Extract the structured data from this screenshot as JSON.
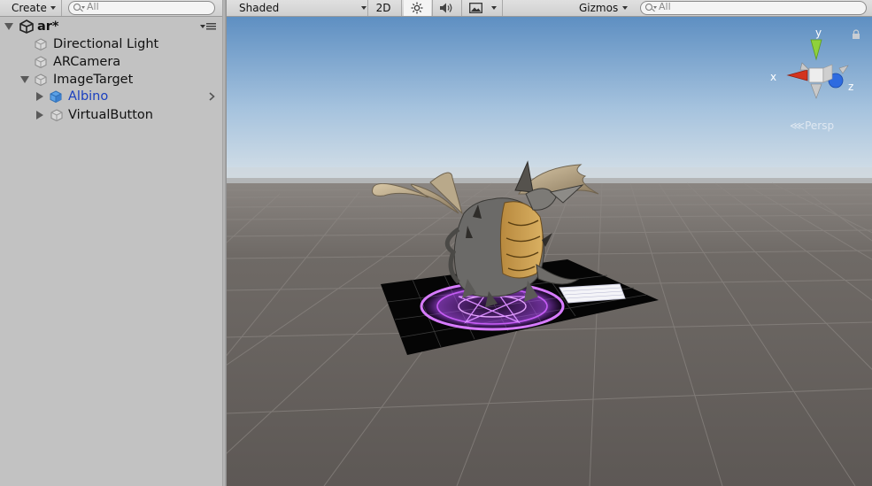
{
  "hierarchy": {
    "create_label": "Create",
    "search_placeholder": "All",
    "scene_name": "ar*",
    "items": [
      {
        "label": "Directional Light"
      },
      {
        "label": "ARCamera"
      },
      {
        "label": "ImageTarget"
      },
      {
        "label": "Albino"
      },
      {
        "label": "VirtualButton"
      }
    ]
  },
  "scene_view": {
    "shading_mode": "Shaded",
    "mode_2d_label": "2D",
    "gizmos_label": "Gizmos",
    "search_placeholder": "All",
    "projection_label": "Persp",
    "axes": {
      "x": "x",
      "y": "y",
      "z": "z"
    }
  },
  "colors": {
    "selected_text": "#1a3fbf",
    "axis_x": "#d3331e",
    "axis_y": "#8fd13b",
    "axis_z": "#2e6be0"
  }
}
